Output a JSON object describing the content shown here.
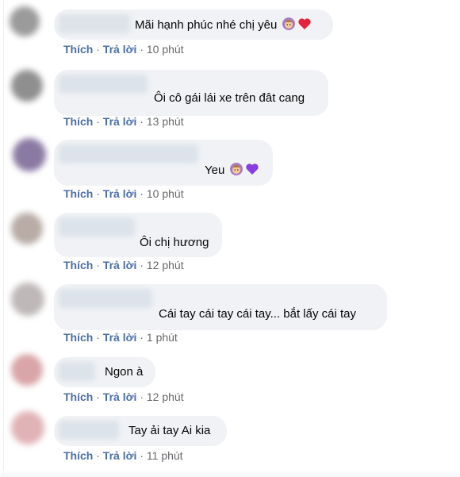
{
  "colors": {
    "bubble_bg": "#f0f2f5",
    "action_link": "#4b6ea8",
    "meta_text": "#65676b"
  },
  "comments": [
    {
      "text": "Mãi hạnh phúc nhé chị yêu",
      "emojis": [
        "woman-gesturing-emoji",
        "red-heart-emoji"
      ],
      "like": "Thích",
      "reply": "Trả lời",
      "time": "10 phút",
      "avatar_color": "#9b9b9b"
    },
    {
      "text": "Ôi cô gái lái xe trên đât cang",
      "emojis": [],
      "like": "Thích",
      "reply": "Trả lời",
      "time": "13 phút",
      "avatar_color": "#8f8f8f"
    },
    {
      "text": "Yeu",
      "emojis": [
        "woman-gesturing-emoji",
        "purple-heart-emoji"
      ],
      "like": "Thích",
      "reply": "Trả lời",
      "time": "10 phút",
      "avatar_color": "#8a7aa3"
    },
    {
      "text": "Ôi chị hương",
      "emojis": [],
      "like": "Thích",
      "reply": "Trả lời",
      "time": "12 phút",
      "avatar_color": "#b9aca6"
    },
    {
      "text": "Cái tay cái tay cái tay... bắt lấy cái tay",
      "emojis": [],
      "like": "Thích",
      "reply": "Trả lời",
      "time": "1 phút",
      "avatar_color": "#bfb8b8"
    },
    {
      "text": "Ngon à",
      "emojis": [],
      "like": "Thích",
      "reply": "Trả lời",
      "time": "12 phút",
      "avatar_color": "#d9a5a8"
    },
    {
      "text": "Tay ải tay Ai kia",
      "emojis": [],
      "like": "Thích",
      "reply": "Trả lời",
      "time": "11 phút",
      "avatar_color": "#e0b3b6"
    }
  ]
}
